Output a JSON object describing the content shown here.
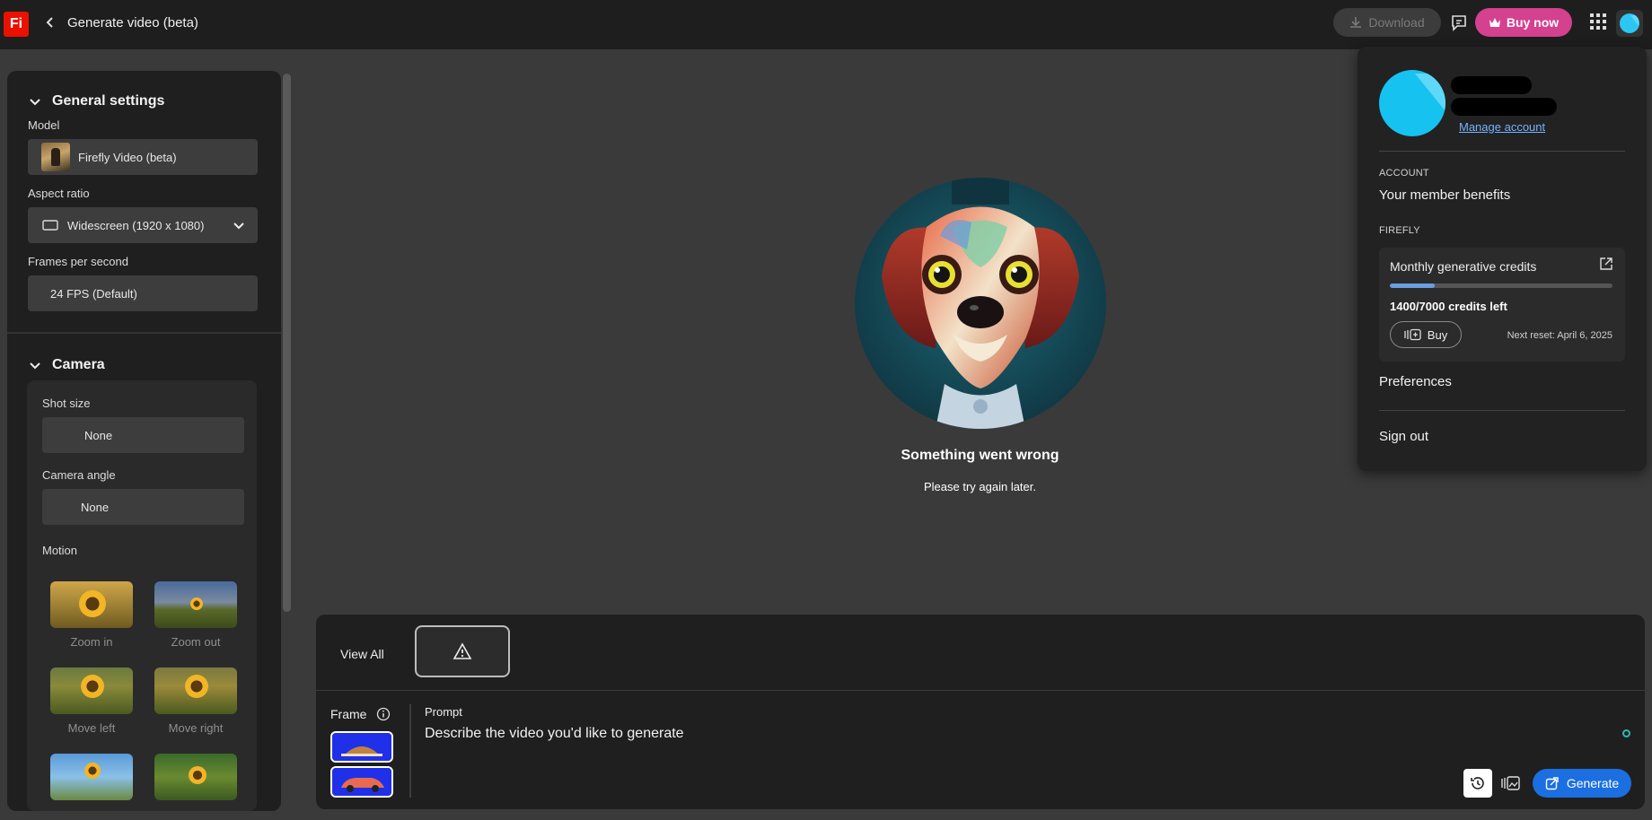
{
  "app": {
    "logo": "Fi",
    "title": "Generate video (beta)"
  },
  "topbar": {
    "download_label": "Download",
    "buy_now_label": "Buy now"
  },
  "general_settings": {
    "heading": "General settings",
    "model_label": "Model",
    "model_value": "Firefly Video (beta)",
    "aspect_label": "Aspect ratio",
    "aspect_value": "Widescreen (1920 x 1080)",
    "fps_label": "Frames per second",
    "fps_value": "24 FPS (Default)"
  },
  "camera": {
    "heading": "Camera",
    "shot_size_label": "Shot size",
    "shot_size_value": "None",
    "angle_label": "Camera angle",
    "angle_value": "None",
    "motion_label": "Motion",
    "motions": [
      {
        "label": "Zoom in"
      },
      {
        "label": "Zoom out"
      },
      {
        "label": "Move left"
      },
      {
        "label": "Move right"
      }
    ]
  },
  "center": {
    "error_title": "Something went wrong",
    "error_subtitle": "Please try again later."
  },
  "bottom": {
    "view_all": "View All",
    "frame_label": "Frame",
    "prompt_label": "Prompt",
    "prompt_placeholder": "Describe the video you'd like to generate",
    "generate_label": "Generate"
  },
  "account_popover": {
    "manage_account": "Manage account",
    "account_caption": "ACCOUNT",
    "member_benefits": "Your member benefits",
    "firefly_caption": "FIREFLY",
    "credits_title": "Monthly generative credits",
    "credits_used_fraction": 0.2,
    "credits_left": "1400/7000 credits left",
    "buy_label": "Buy",
    "next_reset": "Next reset: April 6, 2025",
    "preferences": "Preferences",
    "sign_out": "Sign out"
  },
  "colors": {
    "accent_blue": "#1b6fe0",
    "buy_now_pink": "#d4418f",
    "logo_red": "#eb1000",
    "avatar_cyan": "#16c2f0"
  }
}
